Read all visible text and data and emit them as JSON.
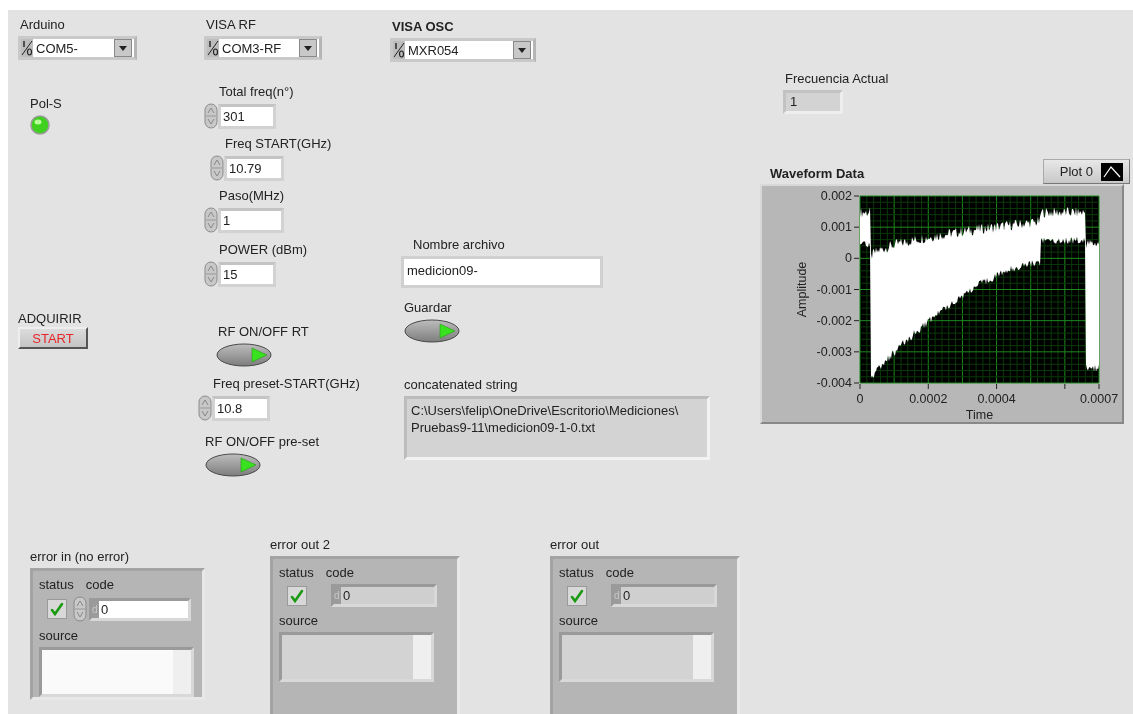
{
  "visa_controls": [
    {
      "label": "Arduino",
      "label_bold": false,
      "value": "COM5-"
    },
    {
      "label": "VISA RF",
      "label_bold": false,
      "value": "COM3-RF"
    },
    {
      "label": "VISA OSC",
      "label_bold": true,
      "value": "MXR054"
    }
  ],
  "leds": [
    {
      "label": "Pol-S",
      "on": true
    }
  ],
  "numeric_controls": [
    {
      "label": "Total freq(n°)",
      "value": "301"
    },
    {
      "label": "Freq START(GHz)",
      "value": "10.79"
    },
    {
      "label": "Paso(MHz)",
      "value": "1"
    },
    {
      "label": "POWER (dBm)",
      "value": "15"
    },
    {
      "label": "Freq preset-START(GHz)",
      "value": "10.8"
    }
  ],
  "numeric_indicators": [
    {
      "label": "Frecuencia Actual",
      "value": "1"
    }
  ],
  "buttons": [
    {
      "label": "ADQUIRIR",
      "text": "START"
    }
  ],
  "switches": [
    {
      "label": "RF ON/OFF RT"
    },
    {
      "label": "RF ON/OFF pre-set"
    },
    {
      "label": "Guardar"
    }
  ],
  "string_controls": [
    {
      "label": "Nombre archivo",
      "value": "medicion09-"
    }
  ],
  "string_indicators": [
    {
      "label": "concatenated string",
      "lines": [
        "C:\\Users\\felip\\OneDrive\\Escritorio\\Mediciones\\",
        "Pruebas9-11\\medicion09-1-0.txt"
      ]
    }
  ],
  "graph": {
    "title": "Waveform Data",
    "legend": "Plot 0",
    "xlabel": "Time",
    "ylabel": "Amplitude",
    "xticks": [
      "0",
      "0.0002",
      "0.0004",
      "0.0007"
    ],
    "yticks": [
      "0.002",
      "0.001",
      "0",
      "-0.001",
      "-0.002",
      "-0.003",
      "-0.004"
    ]
  },
  "error_clusters": [
    {
      "label": "error in (no error)",
      "kind": "control",
      "status_label": "status",
      "status": false,
      "code_label": "code",
      "code_radix": "d",
      "code": "0",
      "source_label": "source"
    },
    {
      "label": "error out 2",
      "kind": "indicator",
      "status_label": "status",
      "status": false,
      "code_label": "code",
      "code_radix": "d",
      "code": "0",
      "source_label": "source"
    },
    {
      "label": "error out",
      "kind": "indicator",
      "status_label": "status",
      "status": false,
      "code_label": "code",
      "code_radix": "d",
      "code": "0",
      "source_label": "source"
    }
  ]
}
